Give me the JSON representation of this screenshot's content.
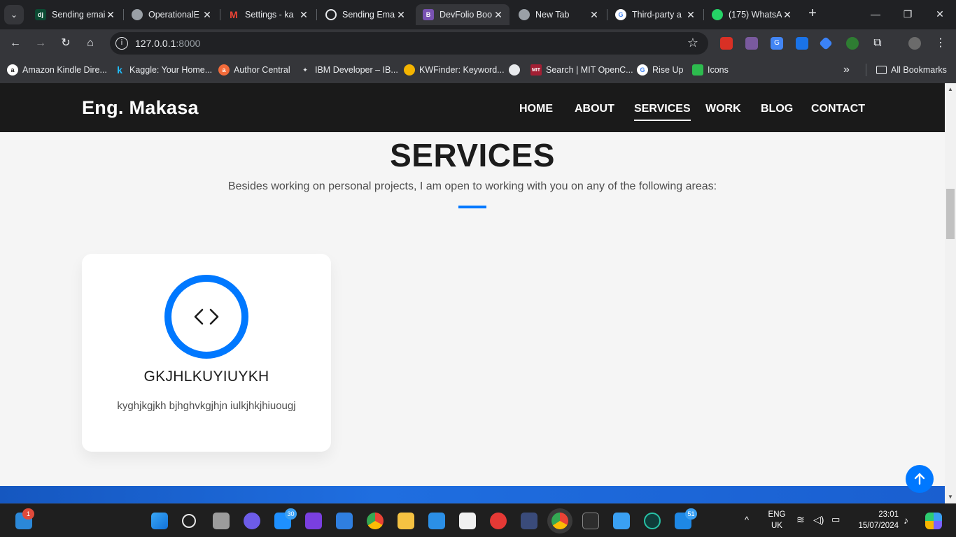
{
  "browser": {
    "tabs": [
      {
        "title": "Sending email",
        "favicon_text": "dj",
        "favicon_color": "#0c4b33",
        "active": false
      },
      {
        "title": "OperationalE",
        "favicon_text": "",
        "favicon_color": "#9aa0a6",
        "active": false
      },
      {
        "title": "Settings - ka",
        "favicon_text": "M",
        "favicon_color": "#ea4335",
        "active": false
      },
      {
        "title": "Sending Ema",
        "favicon_text": "",
        "favicon_color": "#e8eaed",
        "active": false
      },
      {
        "title": "DevFolio Boo",
        "favicon_text": "B",
        "favicon_color": "#7952b3",
        "active": true
      },
      {
        "title": "New Tab",
        "favicon_text": "",
        "favicon_color": "#9aa0a6",
        "active": false
      },
      {
        "title": "Third-party a",
        "favicon_text": "G",
        "favicon_color": "#4285f4",
        "active": false
      },
      {
        "title": "(175) WhatsA",
        "favicon_text": "",
        "favicon_color": "#25d366",
        "active": false
      }
    ],
    "url_host": "127.0.0.1",
    "url_port": ":8000",
    "bookmarks": [
      {
        "label": "Amazon Kindle Dire...",
        "icon_text": "a",
        "icon_color": "#ff9900"
      },
      {
        "label": "Kaggle: Your Home...",
        "icon_text": "k",
        "icon_color": "#20beff"
      },
      {
        "label": "Author Central",
        "icon_text": "a",
        "icon_color": "#f26b3a"
      },
      {
        "label": "IBM Developer – IB...",
        "icon_text": "",
        "icon_color": "#8d8d8d"
      },
      {
        "label": "KWFinder: Keyword...",
        "icon_text": "",
        "icon_color": "#f4b400"
      },
      {
        "label": "",
        "icon_text": "",
        "icon_color": "#e8eaed"
      },
      {
        "label": "Search | MIT OpenC...",
        "icon_text": "MIT",
        "icon_color": "#a31f34"
      },
      {
        "label": "Rise Up",
        "icon_text": "G",
        "icon_color": "#4285f4"
      },
      {
        "label": "Icons",
        "icon_text": "",
        "icon_color": "#2dbb4e"
      }
    ],
    "more_bookmarks": "»",
    "all_bookmarks": "All Bookmarks"
  },
  "site": {
    "brand": "Eng. Makasa",
    "menu": [
      "HOME",
      "ABOUT",
      "SERVICES",
      "WORK",
      "BLOG",
      "CONTACT"
    ],
    "active_menu": "SERVICES",
    "section_title": "SERVICES",
    "section_subtitle": "Besides working on personal projects, I am open to working with you on any of the following areas:",
    "accent_color": "#0078ff",
    "services": [
      {
        "icon": "code-icon",
        "title": "GKJHLKUYIUYKH",
        "description": "kyghjkgjkh bjhghvkgjhjn iulkjhkjhiuougj"
      }
    ]
  },
  "taskbar": {
    "widgets_badge": "1",
    "mail_badge": "30",
    "outlook_badge": "51",
    "language": "ENG",
    "region": "UK",
    "time": "23:01",
    "date": "15/07/2024"
  }
}
